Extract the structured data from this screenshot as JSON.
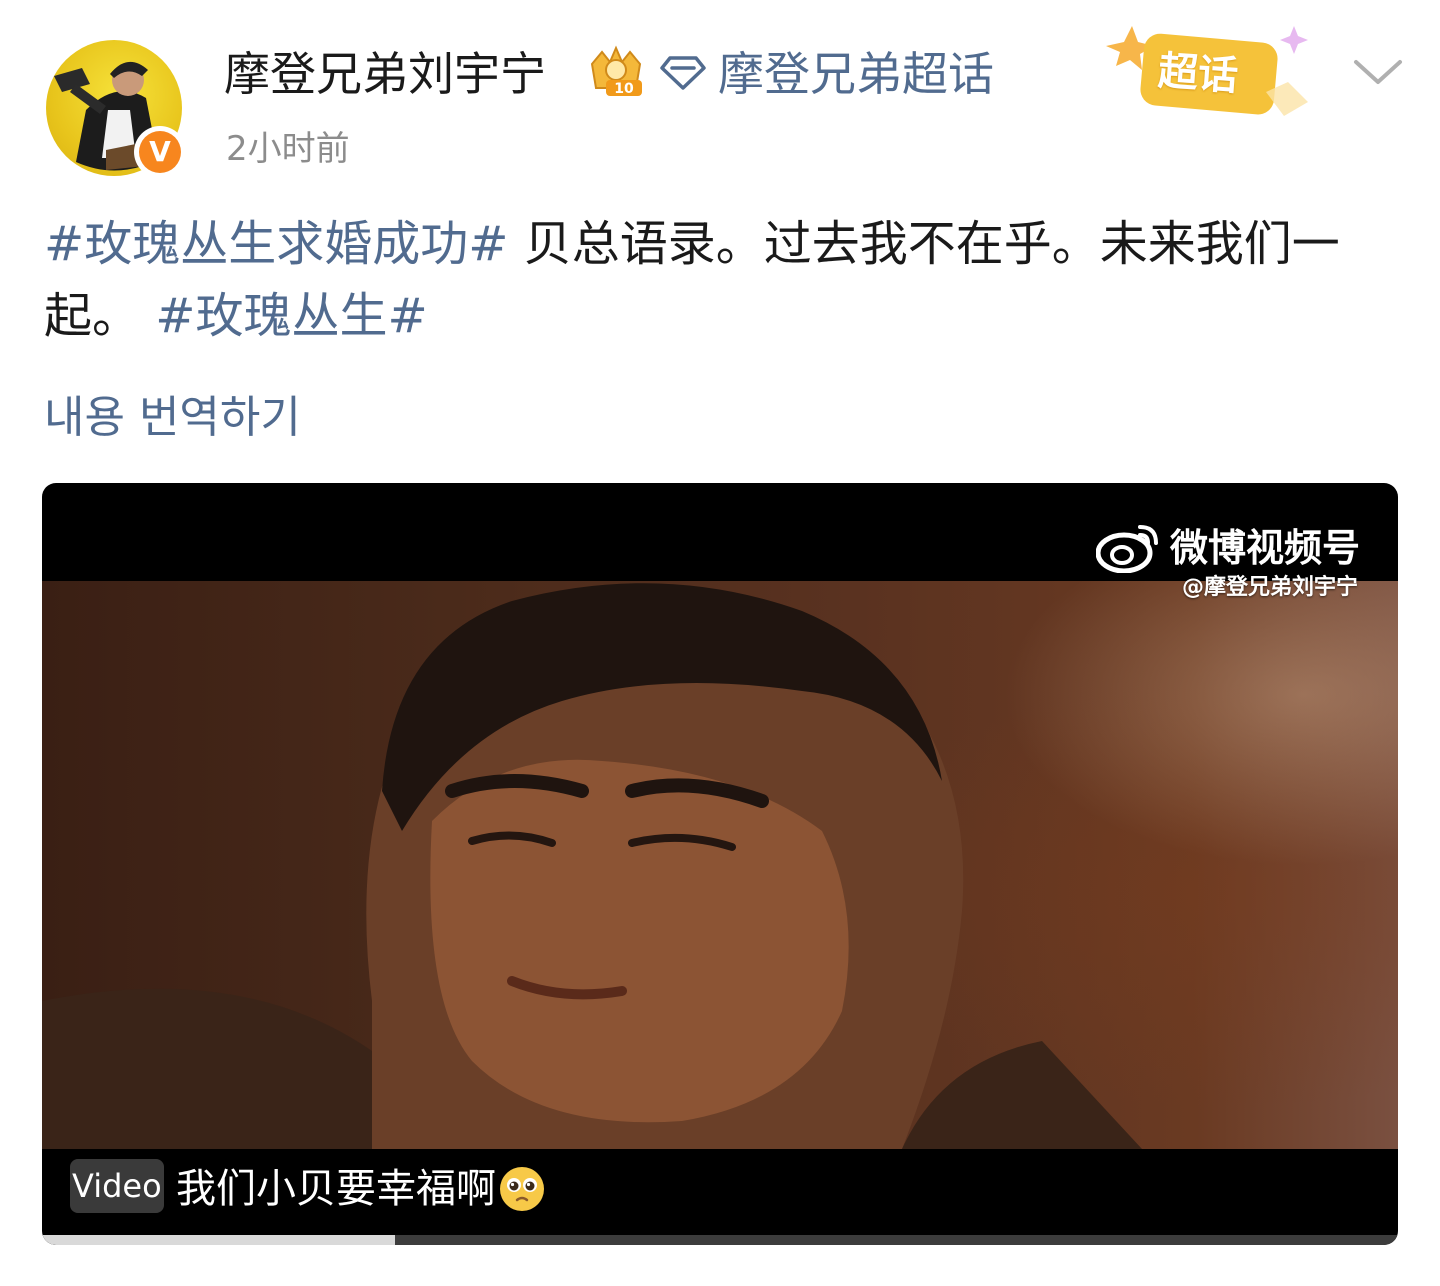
{
  "header": {
    "username": "摩登兄弟刘宇宁",
    "level_icon": "crown-level-10-icon",
    "level_text": "10",
    "topic_icon": "diamond-icon",
    "topic_link": "摩登兄弟超话",
    "supertopic_badge": "超话",
    "timestamp": "2小时前",
    "verified_icon": "verified-v-icon",
    "verified_text": "V",
    "more_icon": "chevron-down-icon"
  },
  "post": {
    "hashtag_1": "#玫瑰丛生求婚成功#",
    "body": " 贝总语录。过去我不在乎。未来我们一起。",
    "hashtag_2": "#玫瑰丛生#",
    "translate_link": "내용 번역하기"
  },
  "video": {
    "watermark_brand": "微博视频号",
    "watermark_handle": "@摩登兄弟刘宇宁",
    "tag": "Video",
    "title": "我们小贝要幸福啊",
    "emoji": "pleading-face-emoji",
    "progress": 0.26
  },
  "colors": {
    "link": "#516b8f",
    "text": "#1a1a1a",
    "muted": "#8c8c8c",
    "verified": "#f7861e",
    "supertopic": "#f5c23a"
  }
}
